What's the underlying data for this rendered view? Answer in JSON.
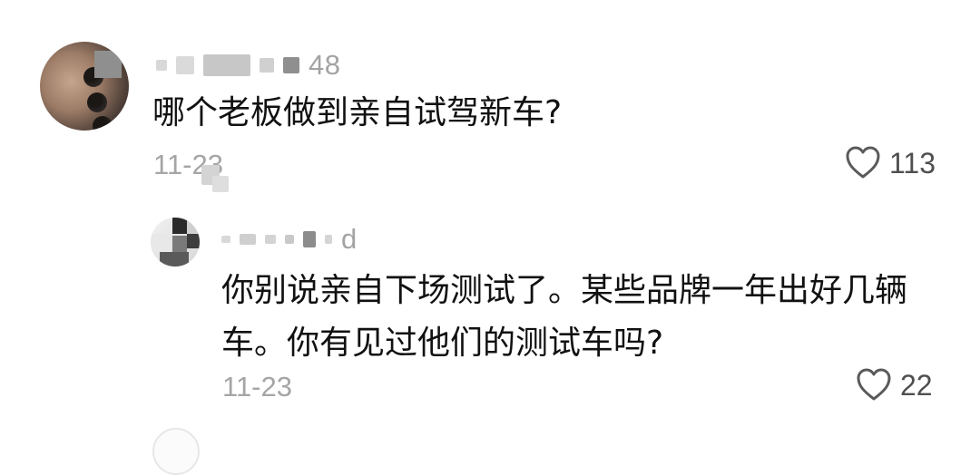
{
  "comments": [
    {
      "username_tail": "48",
      "text": "哪个老板做到亲自试驾新车?",
      "date": "11-23",
      "likes": "113"
    },
    {
      "username_tail": "d",
      "text": "你别说亲自下场测试了。某些品牌一年出好几辆车。你有见过他们的测试车吗?",
      "date": "11-23",
      "likes": "22"
    }
  ],
  "icons": {
    "like": "heart-icon"
  },
  "colors": {
    "text": "#111111",
    "meta": "#a5a5a5",
    "likes": "#4f4f4f"
  }
}
